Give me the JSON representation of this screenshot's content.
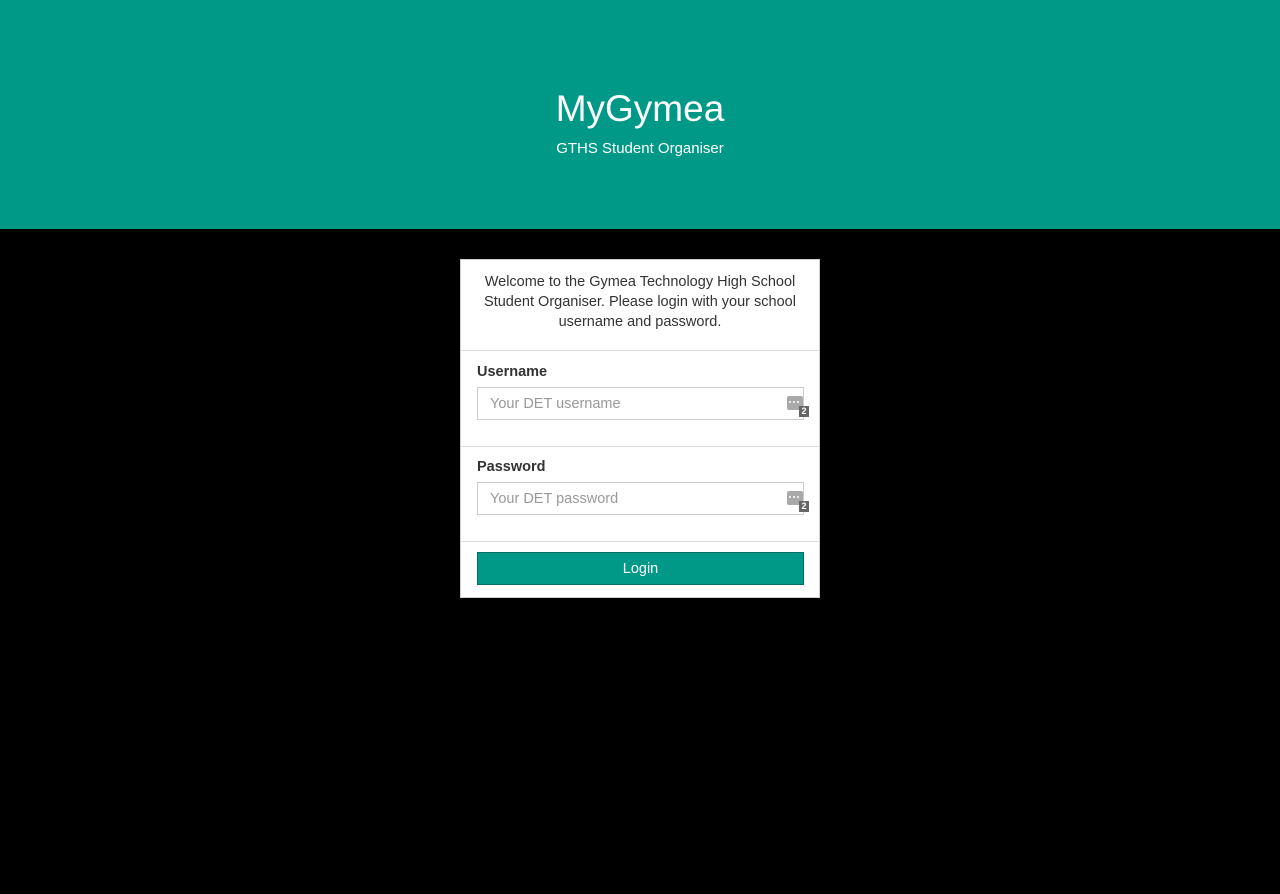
{
  "header": {
    "title": "MyGymea",
    "subtitle": "GTHS Student Organiser"
  },
  "login_card": {
    "welcome_text": "Welcome to the Gymea Technology High School Student Organiser. Please login with your school username and password.",
    "username": {
      "label": "Username",
      "placeholder": "Your DET username",
      "value": "",
      "manager_badge": "2"
    },
    "password": {
      "label": "Password",
      "placeholder": "Your DET password",
      "value": "",
      "manager_badge": "2"
    },
    "login_label": "Login"
  },
  "colors": {
    "brand": "#009887",
    "background": "#000000",
    "card": "#ffffff"
  },
  "icons": {
    "password_manager": "password-manager-icon"
  }
}
